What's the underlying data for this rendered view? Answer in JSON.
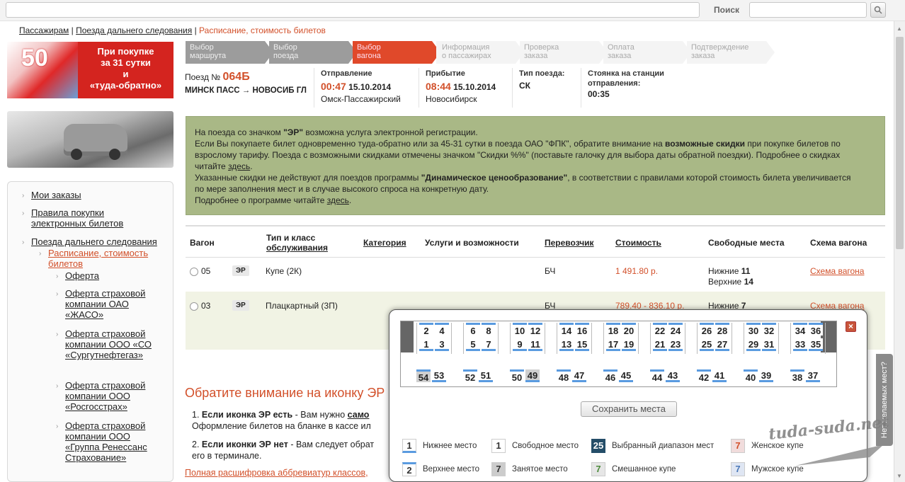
{
  "search": {
    "label": "Поиск"
  },
  "breadcrumb": {
    "items": [
      "Пассажирам",
      "Поезда дальнего следования"
    ],
    "current": "Расписание, стоимость билетов"
  },
  "promo": {
    "line1": "При покупке",
    "line2": "за 31 сутки",
    "line3": "и",
    "line4": "«туда-обратно»",
    "badge": "50"
  },
  "leftnav": {
    "items": [
      {
        "label": "Мои заказы"
      },
      {
        "label": "Правила покупки электронных билетов"
      },
      {
        "label": "Поезда дальнего следования"
      },
      {
        "label": "Расписание, стоимость билетов"
      },
      {
        "label": "Оферта"
      },
      {
        "label": "Оферта страховой компании ОАО «ЖАСО»"
      },
      {
        "label": "Оферта страховой компании ООО «СО «Сургутнефтегаз»"
      },
      {
        "label": "Оферта страховой компании ООО «Росгосстрах»"
      },
      {
        "label": "Оферта страховой компании ООО «Группа Ренессанс Страхование»"
      }
    ]
  },
  "steps": [
    {
      "line1": "Выбор",
      "line2": "маршрута"
    },
    {
      "line1": "Выбор",
      "line2": "поезда"
    },
    {
      "line1": "Выбор",
      "line2": "вагона"
    },
    {
      "line1": "Информация",
      "line2": "о пассажирах"
    },
    {
      "line1": "Проверка",
      "line2": "заказа"
    },
    {
      "line1": "Оплата",
      "line2": "заказа"
    },
    {
      "line1": "Подтверждение",
      "line2": "заказа"
    }
  ],
  "train": {
    "label": "Поезд №",
    "number": "064Б",
    "route": "МИНСК ПАСС → НОВОСИБ ГЛ",
    "dep_label": "Отправление",
    "dep_time": "00:47",
    "dep_date": "15.10.2014",
    "dep_station": "Омск-Пассажирский",
    "arr_label": "Прибытие",
    "arr_time": "08:44",
    "arr_date": "15.10.2014",
    "arr_station": "Новосибирск",
    "type_label": "Тип поезда:",
    "type_value": "СК",
    "stop_label1": "Стоянка на станции",
    "stop_label2": "отправления:",
    "stop_value": "00:35"
  },
  "notice": {
    "l1a": "На поезда со значком ",
    "l1b": "\"ЭР\"",
    "l1c": " возможна услуга электронной регистрации.",
    "l2a": "Если Вы покупаете билет одновременно туда-обратно или за 45-31 сутки в поезда ОАО \"ФПК\", обратите внимание на ",
    "l2b": "возможные скидки",
    "l2c": " при покупке билетов по",
    "l3": "взрослому тарифу. Поезда с возможными скидками отмечены значком \"Скидки %%\" (поставьте галочку для выбора даты обратной поездки). Подробнее о скидках",
    "l4a": "читайте ",
    "l4link": "здесь",
    "l4b": ".",
    "l5a": "Указанные скидки не действуют для поездов программы ",
    "l5b": "\"Динамическое ценообразование\"",
    "l5c": ", в соответствии с правилами которой стоимость билета увеличивается",
    "l6": "по мере заполнения мест и в случае высокого спроса на конкретную дату.",
    "l7a": "Подробнее о программе читайте ",
    "l7link": "здесь",
    "l7b": "."
  },
  "table": {
    "headers": {
      "wagon": "Вагон",
      "class1": "Тип и класс",
      "class2": "обслуживания",
      "category": "Категория",
      "services": "Услуги и возможности",
      "carrier": "Перевозчик",
      "price": "Стоимость",
      "free": "Свободные места",
      "schema": "Схема вагона"
    },
    "rows": [
      {
        "num": "05",
        "badge": "ЭР",
        "type": "Купе (2К)",
        "carrier": "БЧ",
        "price": "1 491.80 р.",
        "free1_label": "Нижние ",
        "free1_value": "11",
        "free2_label": "Верхние ",
        "free2_value": "14",
        "schema": "Схема вагона"
      },
      {
        "num": "03",
        "badge": "ЭР",
        "type": "Плацкартный (3П)",
        "carrier": "БЧ",
        "price": "789.40 - 836.10 р.",
        "free1_label": "Нижние ",
        "free1_value": "7",
        "schema": "Схема вагона"
      }
    ]
  },
  "attention": {
    "title": "Обратите внимание на иконку ЭР",
    "p1a": "1. ",
    "p1b": "Если иконка ЭР есть",
    "p1c": " - Вам нужно ",
    "p1d": "само",
    "p1e": "Оформление билетов на бланке в кассе ил",
    "p2a": "2. ",
    "p2b": "Если иконки ЭР нет",
    "p2c": " - Вам следует обрат",
    "p2d": "его в терминале.",
    "link": "Полная расшифровка аббревиатур классов,"
  },
  "popup": {
    "top_pairs": [
      [
        "2",
        "4"
      ],
      [
        "6",
        "8"
      ],
      [
        "10",
        "12"
      ],
      [
        "14",
        "16"
      ],
      [
        "18",
        "20"
      ],
      [
        "22",
        "24"
      ],
      [
        "26",
        "28"
      ],
      [
        "30",
        "32"
      ],
      [
        "34",
        "36"
      ]
    ],
    "low_pairs": [
      [
        "1",
        "3"
      ],
      [
        "5",
        "7"
      ],
      [
        "9",
        "11"
      ],
      [
        "13",
        "15"
      ],
      [
        "17",
        "19"
      ],
      [
        "21",
        "23"
      ],
      [
        "25",
        "27"
      ],
      [
        "29",
        "31"
      ],
      [
        "33",
        "35"
      ]
    ],
    "side_pairs": [
      [
        "54",
        "53"
      ],
      [
        "52",
        "51"
      ],
      [
        "50",
        "49"
      ],
      [
        "48",
        "47"
      ],
      [
        "46",
        "45"
      ],
      [
        "44",
        "43"
      ],
      [
        "42",
        "41"
      ],
      [
        "40",
        "39"
      ],
      [
        "38",
        "37"
      ]
    ],
    "save_label": "Сохранить места",
    "legend": {
      "lower": "Нижнее место",
      "free": "Свободное место",
      "selected": "Выбранный диапазон мест",
      "female": "Женское купе",
      "upper": "Верхнее место",
      "occupied": "Занятое место",
      "mixed": "Смешанное купе",
      "male": "Мужское купе",
      "n_lower": "1",
      "n_free": "1",
      "n_selected": "25",
      "n_female": "7",
      "n_upper": "2",
      "n_occupied": "7",
      "n_mixed": "7",
      "n_male": "7"
    }
  },
  "feedback": {
    "label": "Нет желаемых мест?"
  },
  "watermark": {
    "text": "tuda-suda.net"
  }
}
